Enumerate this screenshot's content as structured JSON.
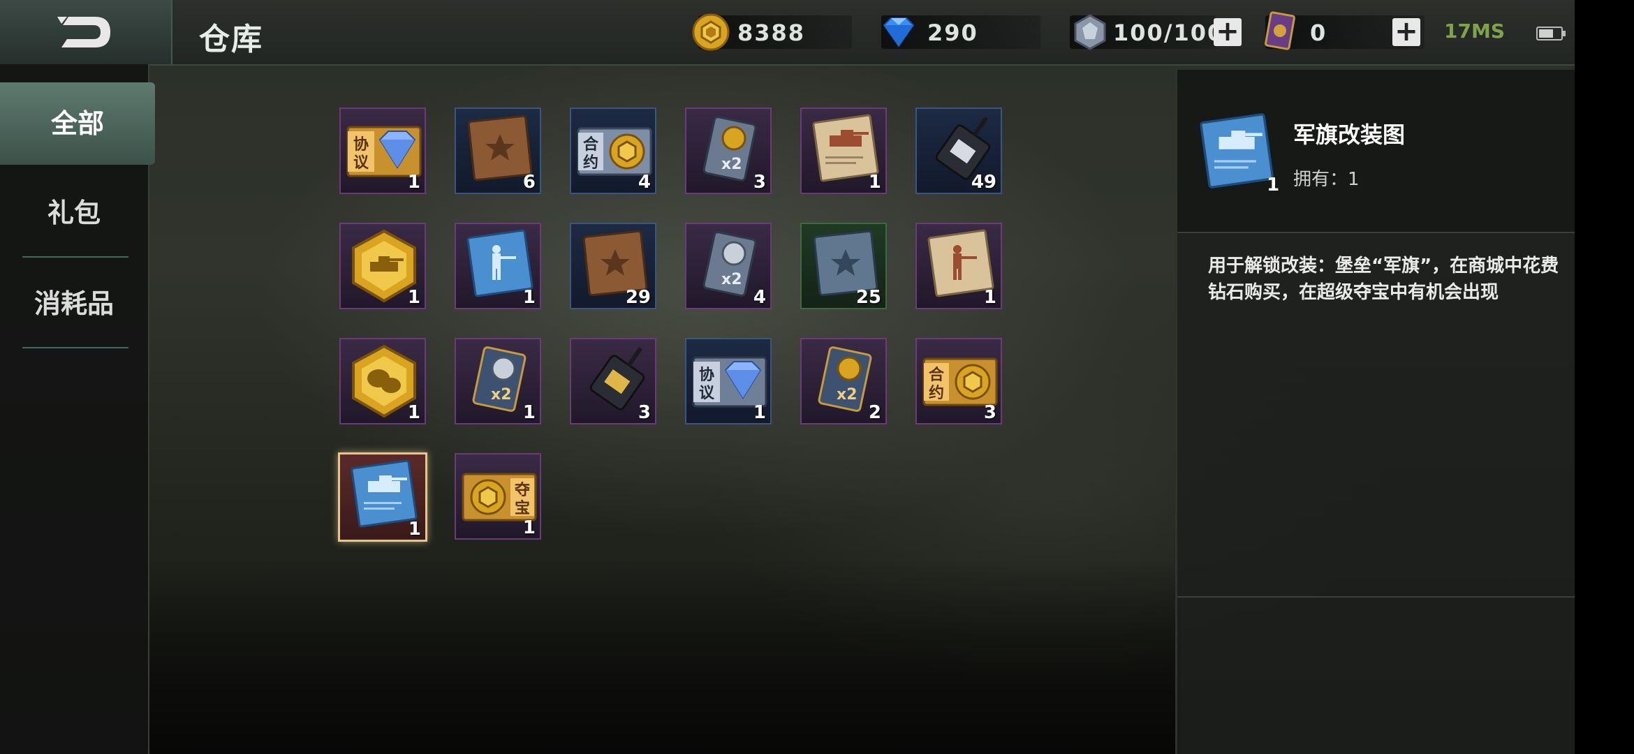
{
  "header": {
    "title": "仓库",
    "resources": [
      {
        "name": "gold",
        "value": "8388"
      },
      {
        "name": "diamond",
        "value": "290"
      },
      {
        "name": "stamina",
        "value": "100/100"
      },
      {
        "name": "card",
        "value": "0"
      }
    ],
    "ping": "17MS",
    "battery_level": 0.7
  },
  "sidebar": {
    "tabs": [
      {
        "label": "全部",
        "active": true
      },
      {
        "label": "礼包",
        "active": false
      },
      {
        "label": "消耗品",
        "active": false
      }
    ]
  },
  "items": [
    {
      "icon": "protocol-diamond-icon",
      "count": "1"
    },
    {
      "icon": "brown-book-icon",
      "count": "6"
    },
    {
      "icon": "contract-ticket-icon",
      "count": "4"
    },
    {
      "icon": "double-gold-card-icon",
      "count": "3"
    },
    {
      "icon": "tank-blueprint-paper-icon",
      "count": "1"
    },
    {
      "icon": "walkie-talkie-icon",
      "count": "49"
    },
    {
      "icon": "tank-badge-icon",
      "count": "1"
    },
    {
      "icon": "soldier-blueprint-blue-icon",
      "count": "1"
    },
    {
      "icon": "brown-book-icon",
      "count": "29"
    },
    {
      "icon": "double-silver-card-icon",
      "count": "4"
    },
    {
      "icon": "blue-book-icon",
      "count": "25"
    },
    {
      "icon": "soldier-blueprint-paper-icon",
      "count": "1"
    },
    {
      "icon": "chat-badge-icon",
      "count": "1"
    },
    {
      "icon": "double-silver-card-icon",
      "count": "1"
    },
    {
      "icon": "gold-walkie-talkie-icon",
      "count": "3"
    },
    {
      "icon": "protocol-diamond-icon",
      "count": "1"
    },
    {
      "icon": "double-gold-card-icon",
      "count": "2"
    },
    {
      "icon": "contract-ticket-icon",
      "count": "3"
    },
    {
      "icon": "tank-blueprint-blue-icon",
      "count": "1"
    },
    {
      "icon": "treasure-ticket-icon",
      "count": "1"
    }
  ],
  "selected_item": {
    "name": "军旗改装图",
    "count": "1",
    "owned": "拥有：1",
    "description": "用于解锁改装：堡垒“军旗”，在商城中花费钻石购买，在超级夺宝中有机会出现"
  },
  "colors": {
    "accent_tab": "#5f7a70",
    "purple_border": "#6b3a78",
    "selected_border": "#e7c68a"
  }
}
